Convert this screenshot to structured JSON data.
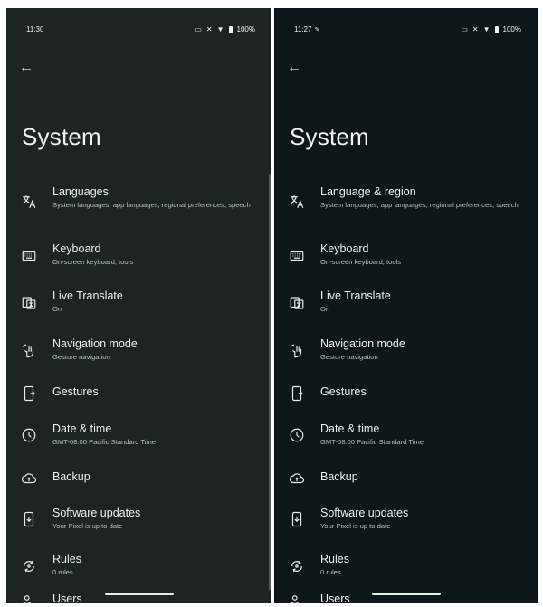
{
  "screens": [
    {
      "status_time": "11:30",
      "status_battery": "100%",
      "title": "System",
      "items": [
        {
          "label": "Languages",
          "sub": "System languages, app languages, regional preferences, speech",
          "icon": "translate-icon"
        },
        {
          "label": "Keyboard",
          "sub": "On-screen keyboard, tools",
          "icon": "keyboard-icon"
        },
        {
          "label": "Live Translate",
          "sub": "On",
          "icon": "live-translate-icon"
        },
        {
          "label": "Navigation mode",
          "sub": "Gesture navigation",
          "icon": "gesture-hand-icon"
        },
        {
          "label": "Gestures",
          "sub": "",
          "icon": "phone-gesture-icon"
        },
        {
          "label": "Date & time",
          "sub": "GMT-08:00 Pacific Standard Time",
          "icon": "clock-icon"
        },
        {
          "label": "Backup",
          "sub": "",
          "icon": "cloud-upload-icon"
        },
        {
          "label": "Software updates",
          "sub": "Your Pixel is up to date",
          "icon": "system-update-icon"
        },
        {
          "label": "Rules",
          "sub": "0 rules",
          "icon": "rules-icon"
        },
        {
          "label": "Users",
          "sub": "",
          "icon": "users-icon"
        }
      ]
    },
    {
      "status_time": "11:27",
      "status_battery": "100%",
      "title": "System",
      "items": [
        {
          "label": "Language & region",
          "sub": "System languages, app languages, regional preferences, speech",
          "icon": "translate-icon"
        },
        {
          "label": "Keyboard",
          "sub": "On-screen keyboard, tools",
          "icon": "keyboard-icon"
        },
        {
          "label": "Live Translate",
          "sub": "On",
          "icon": "live-translate-icon"
        },
        {
          "label": "Navigation mode",
          "sub": "Gesture navigation",
          "icon": "gesture-hand-icon"
        },
        {
          "label": "Gestures",
          "sub": "",
          "icon": "phone-gesture-icon"
        },
        {
          "label": "Date & time",
          "sub": "GMT-08:00 Pacific Standard Time",
          "icon": "clock-icon"
        },
        {
          "label": "Backup",
          "sub": "",
          "icon": "cloud-upload-icon"
        },
        {
          "label": "Software updates",
          "sub": "Your Pixel is up to date",
          "icon": "system-update-icon"
        },
        {
          "label": "Rules",
          "sub": "0 rules",
          "icon": "rules-icon"
        },
        {
          "label": "Users",
          "sub": "",
          "icon": "users-icon"
        }
      ]
    }
  ]
}
